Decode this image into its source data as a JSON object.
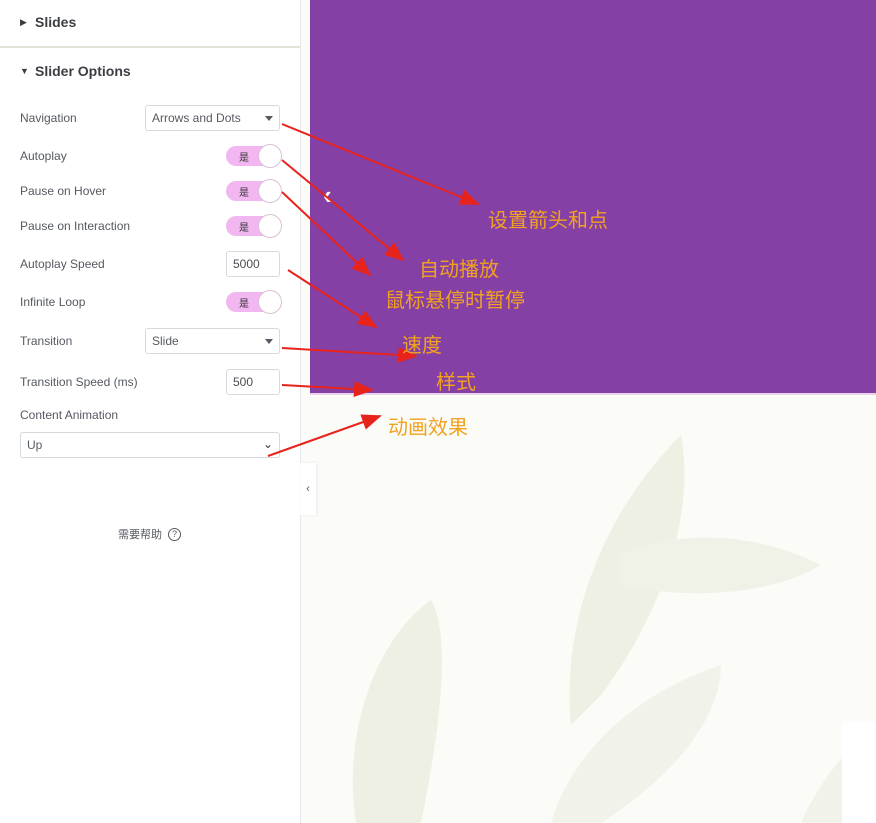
{
  "panel": {
    "slides_heading": "Slides",
    "options_heading": "Slider Options",
    "navigation": {
      "label": "Navigation",
      "value": "Arrows and Dots"
    },
    "autoplay": {
      "label": "Autoplay",
      "value": "是"
    },
    "pause_hover": {
      "label": "Pause on Hover",
      "value": "是"
    },
    "pause_interaction": {
      "label": "Pause on Interaction",
      "value": "是"
    },
    "autoplay_speed": {
      "label": "Autoplay Speed",
      "value": "5000"
    },
    "infinite_loop": {
      "label": "Infinite Loop",
      "value": "是"
    },
    "transition": {
      "label": "Transition",
      "value": "Slide"
    },
    "transition_speed": {
      "label": "Transition Speed (ms)",
      "value": "500"
    },
    "content_animation": {
      "label": "Content Animation",
      "value": "Up"
    },
    "help": "需要帮助",
    "help_symbol": "?"
  },
  "preview": {
    "prev_arrow": "‹",
    "collapse_arrow": "‹"
  },
  "annotations": {
    "arrows_dots": "设置箭头和点",
    "autoplay": "自动播放",
    "pause_hover": "鼠标悬停时暂停",
    "speed": "速度",
    "style": "样式",
    "animation": "动画效果"
  },
  "colors": {
    "slide_bg": "#8540a6",
    "toggle_on": "#f2b6f0",
    "annotation_text": "#f2a21e",
    "annotation_arrow": "#e8231b"
  }
}
